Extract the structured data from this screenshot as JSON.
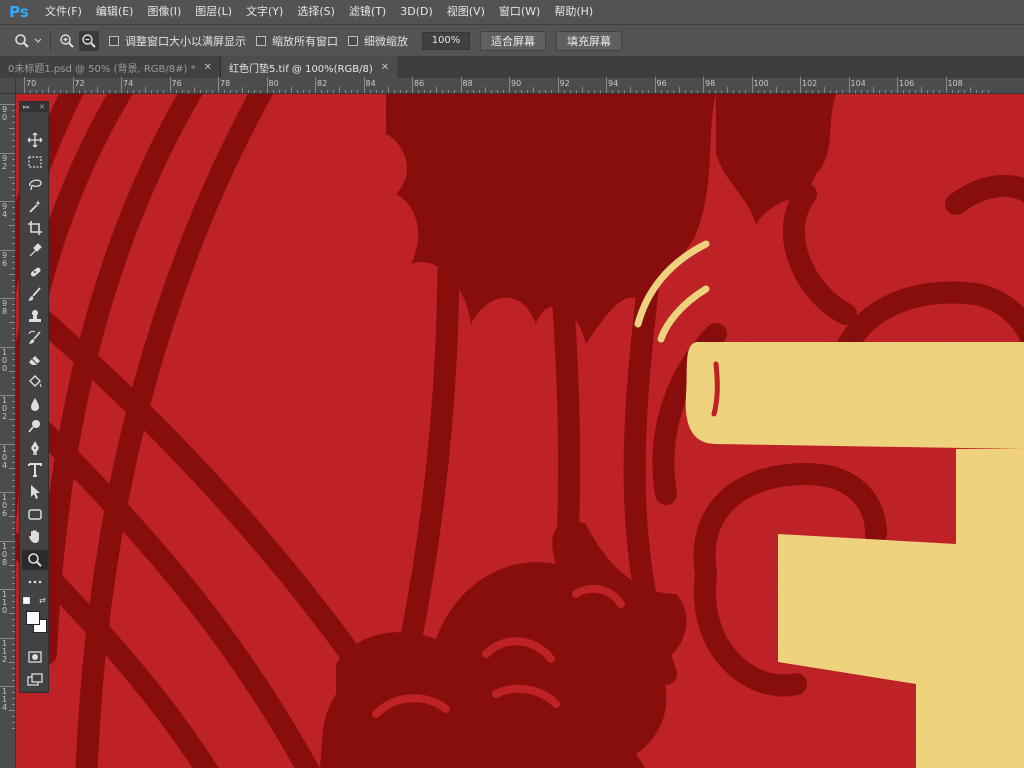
{
  "app": {
    "logo": "Ps"
  },
  "menu": [
    "文件(F)",
    "编辑(E)",
    "图像(I)",
    "图层(L)",
    "文字(Y)",
    "选择(S)",
    "滤镜(T)",
    "3D(D)",
    "视图(V)",
    "窗口(W)",
    "帮助(H)"
  ],
  "options": {
    "tool_icon": "zoom-icon",
    "checkboxes": [
      {
        "label": "调整窗口大小以满屏显示",
        "checked": false
      },
      {
        "label": "缩放所有窗口",
        "checked": false
      },
      {
        "label": "细微缩放",
        "checked": false
      }
    ],
    "zoom_value": "100%",
    "fit_screen": "适合屏幕",
    "fill_screen": "填充屏幕"
  },
  "tabs": [
    {
      "label": "0未标题1.psd @ 50% (背景, RGB/8#) *",
      "active": false
    },
    {
      "label": "红色门垫5.tif @ 100%(RGB/8)",
      "active": true
    }
  ],
  "ruler_h_labels": [
    "70",
    "72",
    "74",
    "76",
    "78",
    "80",
    "82",
    "84",
    "86",
    "88",
    "90",
    "92",
    "94",
    "96",
    "98",
    "100",
    "102",
    "104",
    "106",
    "108"
  ],
  "ruler_v_labels": [
    "90",
    "92",
    "94",
    "96",
    "98",
    "100",
    "102",
    "104",
    "106",
    "108",
    "110",
    "112",
    "114"
  ],
  "canvas": {
    "background": "#c12128",
    "dark": "#8b0d10",
    "gold": "#f3d680"
  },
  "tools": [
    "move-icon",
    "marquee-icon",
    "lasso-icon",
    "magic-wand-icon",
    "crop-icon",
    "eyedropper-icon",
    "healing-icon",
    "brush-icon",
    "stamp-icon",
    "history-brush-icon",
    "eraser-icon",
    "paint-bucket-icon",
    "blur-icon",
    "dodge-icon",
    "pen-icon",
    "type-icon",
    "path-select-icon",
    "shape-icon",
    "hand-icon",
    "zoom-icon",
    "more-icon"
  ]
}
